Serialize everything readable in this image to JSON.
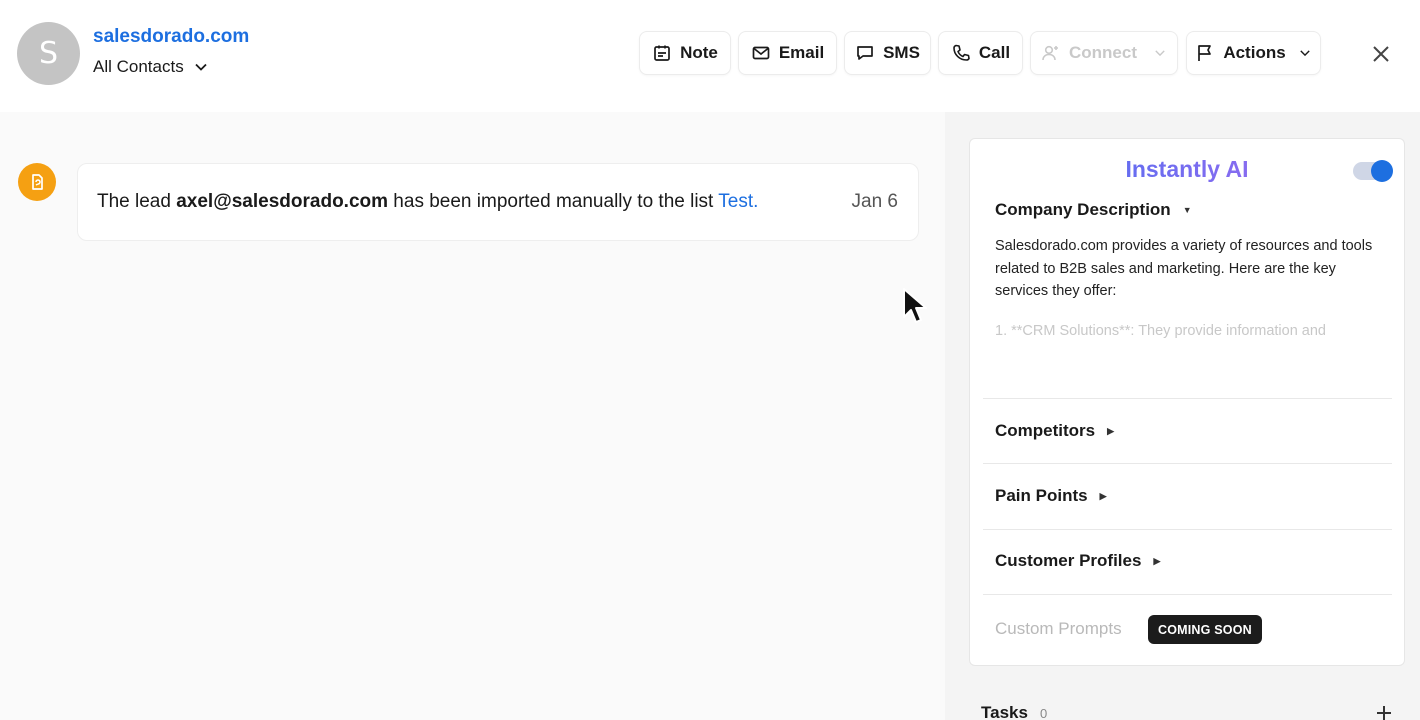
{
  "contact": {
    "avatar_letter": "S",
    "domain": "salesdorado.com",
    "list_label": "All Contacts"
  },
  "toolbar": {
    "note_label": "Note",
    "email_label": "Email",
    "sms_label": "SMS",
    "call_label": "Call",
    "connect_label": "Connect",
    "actions_label": "Actions"
  },
  "timeline": {
    "event_prefix": "The lead ",
    "event_email": "axel@salesdorado.com",
    "event_middle": " has been imported manually to the list ",
    "event_list": "Test",
    "event_suffix": ".",
    "event_date": "Jan 6",
    "icon_color": "#f5a012"
  },
  "ai_panel": {
    "title": "Instantly AI",
    "toggle_on": true,
    "company_description_title": "Company Description",
    "company_description_text": "Salesdorado.com provides a variety of resources and tools related to B2B sales and marketing. Here are the key services they offer:",
    "company_description_fade": "1. **CRM Solutions**: They provide information and",
    "competitors_title": "Competitors",
    "pain_points_title": "Pain Points",
    "customer_profiles_title": "Customer Profiles",
    "custom_prompts_label": "Custom Prompts",
    "coming_soon_badge": "COMING SOON"
  },
  "tasks": {
    "label": "Tasks",
    "count": "0"
  },
  "colors": {
    "accent": "#1d6fe0",
    "badge_bg": "#1c1c1c"
  }
}
